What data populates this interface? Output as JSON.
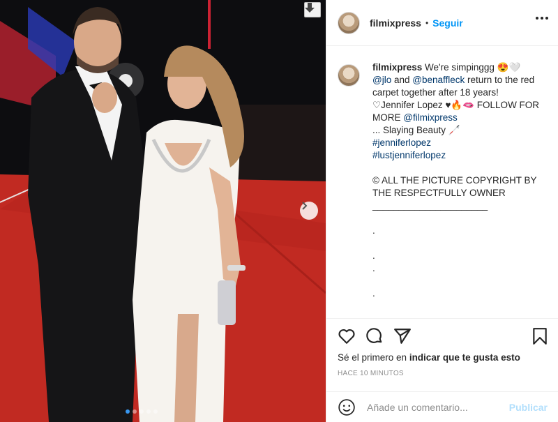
{
  "post": {
    "username": "filmixpress",
    "separator": "•",
    "follow_label": "Seguir"
  },
  "caption": {
    "username": "filmixpress",
    "line1": " We're simpinggg 😍🤍",
    "mention_jlo": "@jlo",
    "and": " and ",
    "mention_ben": "@benaffleck",
    "line2": " return to the red carpet together after 18 years!",
    "line3": "♡Jennifer Lopez ♥🔥🫦 FOLLOW FOR MORE ",
    "mention_filmix": "@filmixpress",
    "line4": "... Slaying Beauty 🦯",
    "hashtag1": "#jenniferlopez",
    "hashtag2": "#lustjenniferlopez",
    "copyright": "© ALL THE PICTURE COPYRIGHT BY THE RESPECTFULLY OWNER",
    "underline": "______________________",
    "dot1": ".",
    "dot2": ".",
    "dot3": ".",
    "dot4": "."
  },
  "actions": {
    "like_icon": "heart-icon",
    "comment_icon": "comment-icon",
    "share_icon": "share-icon",
    "save_icon": "bookmark-icon",
    "likes_prefix": "Sé el primero en ",
    "likes_link": "indicar que te gusta esto",
    "timestamp": "HACE 10 MINUTOS"
  },
  "comment": {
    "placeholder": "Añade un comentario...",
    "publish_label": "Publicar",
    "emoji_icon": "smiley-icon"
  },
  "carousel": {
    "download_icon": "download-arrow-icon",
    "next_icon": "chevron-right-icon",
    "slide_count": 5,
    "active_slide": 1
  },
  "colors": {
    "link": "#00376b",
    "follow": "#0095f6",
    "publish_disabled": "#b2dffc",
    "carpet": "#c62a22"
  }
}
